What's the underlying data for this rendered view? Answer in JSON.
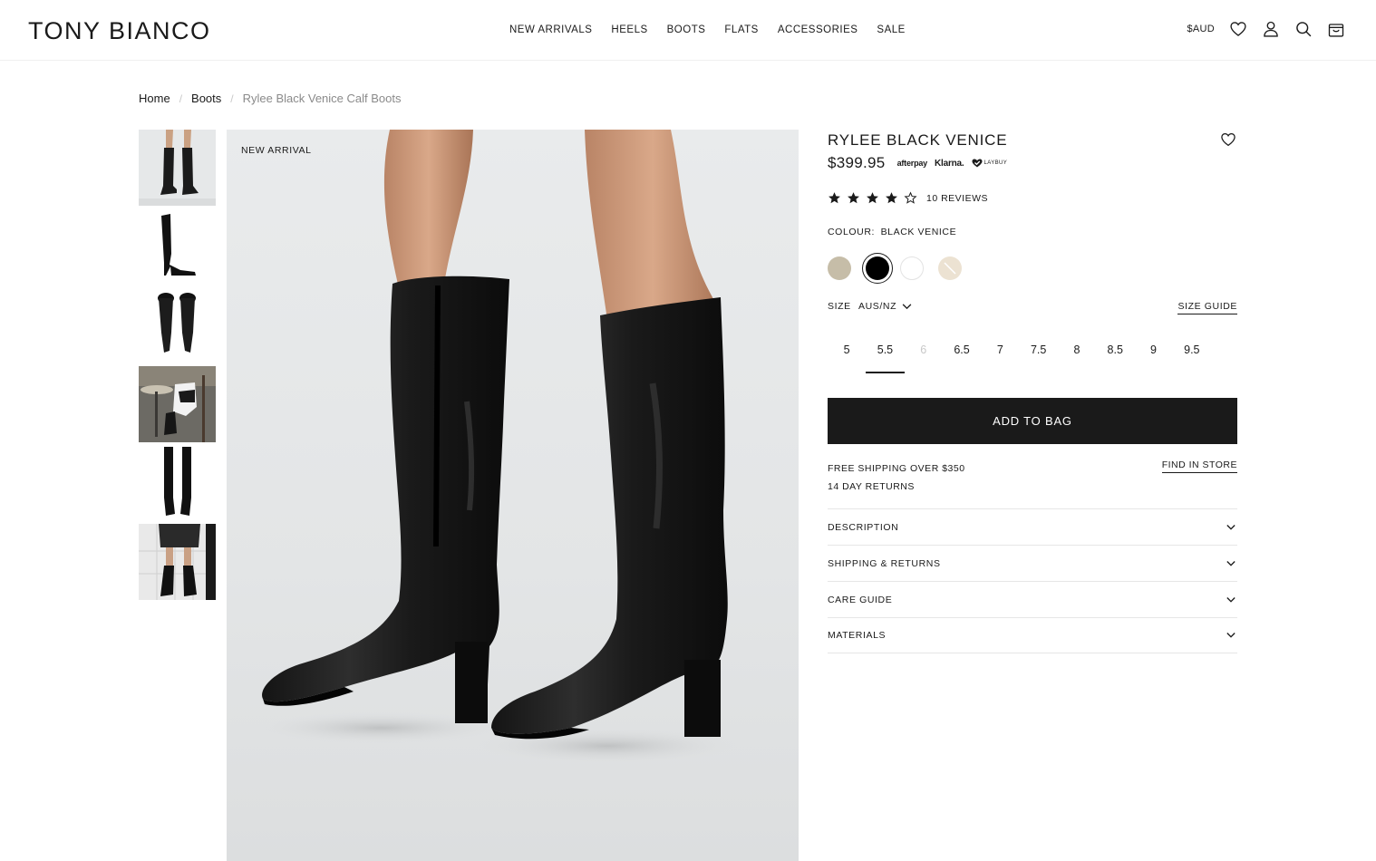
{
  "header": {
    "logo": "TONY BIANCO",
    "nav": [
      "NEW ARRIVALS",
      "HEELS",
      "BOOTS",
      "FLATS",
      "ACCESSORIES",
      "SALE"
    ],
    "currency": "$AUD",
    "icons": [
      "heart-icon",
      "user-icon",
      "search-icon",
      "bag-icon"
    ]
  },
  "breadcrumb": [
    "Home",
    "Boots",
    "Rylee Black Venice Calf Boots"
  ],
  "gallery": {
    "thumbnails": [
      "boots-front-on-model",
      "boot-side-profile",
      "boots-pair-top",
      "model-seated-cafe",
      "boots-pair-front",
      "model-walking-street"
    ],
    "badge": "NEW ARRIVAL"
  },
  "product": {
    "title": "RYLEE BLACK VENICE",
    "price": "$399.95",
    "payment_options": [
      "afterpay",
      "Klarna.",
      "LAYBUY"
    ],
    "rating": 4,
    "rating_max": 5,
    "reviews": "10 REVIEWS",
    "colour_label": "COLOUR:",
    "colour_value": "BLACK VENICE",
    "colours": [
      {
        "name": "taupe",
        "hex": "#c6bda8"
      },
      {
        "name": "black",
        "hex": "#000000",
        "selected": true
      },
      {
        "name": "white",
        "hex": "#ffffff"
      },
      {
        "name": "cream",
        "hex": "#ece2d2"
      }
    ],
    "size_label": "SIZE",
    "size_region": "AUS/NZ",
    "size_guide": "SIZE GUIDE",
    "sizes": [
      {
        "label": "5"
      },
      {
        "label": "5.5",
        "selected": true
      },
      {
        "label": "6",
        "unavailable": true
      },
      {
        "label": "6.5"
      },
      {
        "label": "7"
      },
      {
        "label": "7.5"
      },
      {
        "label": "8"
      },
      {
        "label": "8.5"
      },
      {
        "label": "9"
      },
      {
        "label": "9.5"
      }
    ],
    "add_to_bag": "ADD TO BAG",
    "shipping_line1": "FREE SHIPPING OVER $350",
    "shipping_line2": "14 DAY RETURNS",
    "find_in_store": "FIND IN STORE",
    "accordion": [
      "DESCRIPTION",
      "SHIPPING & RETURNS",
      "CARE GUIDE",
      "MATERIALS"
    ]
  }
}
